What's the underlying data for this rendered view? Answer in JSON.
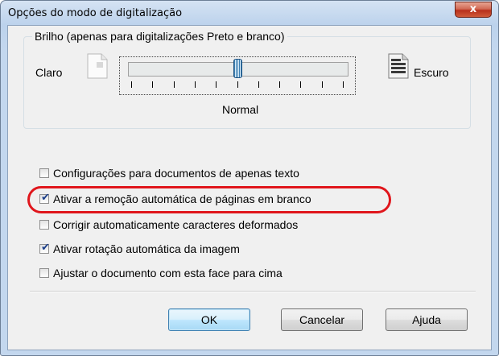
{
  "window": {
    "title": "Opções do modo de digitalização",
    "close_label": "x"
  },
  "brightness": {
    "group_title": "Brilho (apenas para digitalizações Preto e branco)",
    "light_label": "Claro",
    "dark_label": "Escuro",
    "slider_value_label": "Normal",
    "slider_position_fraction": 0.5,
    "tick_count": 11
  },
  "options": [
    {
      "label": "Configurações para documentos de apenas texto",
      "checked": false
    },
    {
      "label": "Ativar a remoção automática de páginas em branco",
      "checked": true
    },
    {
      "label": "Corrigir automaticamente caracteres deformados",
      "checked": false
    },
    {
      "label": "Ativar rotação automática da imagem",
      "checked": true
    },
    {
      "label": "Ajustar o documento com esta face para cima",
      "checked": false
    }
  ],
  "buttons": {
    "ok": "OK",
    "cancel": "Cancelar",
    "help": "Ajuda"
  },
  "colors": {
    "highlight": "#e0161c",
    "check": "#1c3f8a",
    "default_button_border": "#3c7fb1"
  }
}
